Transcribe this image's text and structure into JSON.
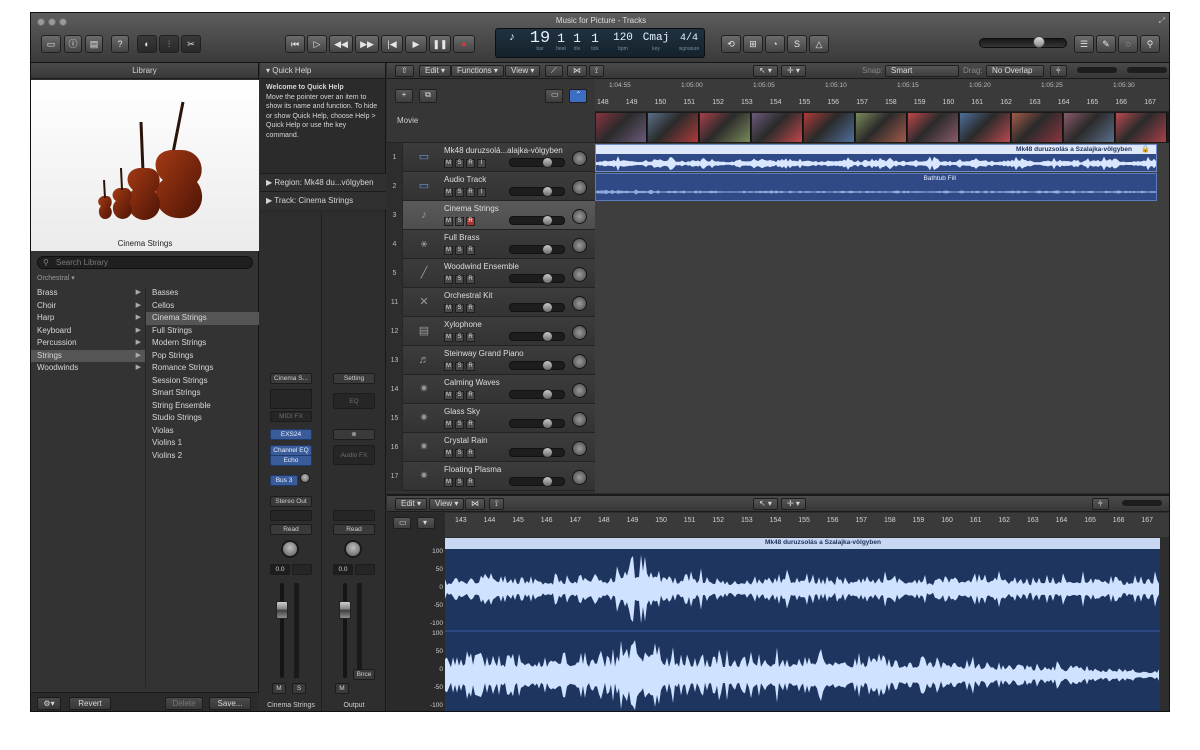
{
  "window": {
    "title": "Music for Picture - Tracks"
  },
  "lcd": {
    "bar": "19",
    "beat": "1",
    "div": "1",
    "tick": "1",
    "tempo": "120",
    "key": "Cmaj",
    "signature": "4/4",
    "labels": {
      "bar": "bar",
      "beat": "beat",
      "div": "div",
      "tick": "tick",
      "bpm": "bpm",
      "key": "key",
      "signature": "signature"
    }
  },
  "library": {
    "header": "Library",
    "selected_instrument": "Cinema Strings",
    "search_placeholder": "Search Library",
    "path": "Orchestral",
    "categories": [
      {
        "label": "Brass",
        "selected": false
      },
      {
        "label": "Choir",
        "selected": false
      },
      {
        "label": "Harp",
        "selected": false
      },
      {
        "label": "Keyboard",
        "selected": false
      },
      {
        "label": "Percussion",
        "selected": false
      },
      {
        "label": "Strings",
        "selected": true
      },
      {
        "label": "Woodwinds",
        "selected": false
      }
    ],
    "patches": [
      {
        "label": "Basses",
        "selected": false
      },
      {
        "label": "Cellos",
        "selected": false
      },
      {
        "label": "Cinema Strings",
        "selected": true
      },
      {
        "label": "Full Strings",
        "selected": false
      },
      {
        "label": "Modern Strings",
        "selected": false
      },
      {
        "label": "Pop Strings",
        "selected": false
      },
      {
        "label": "Romance Strings",
        "selected": false
      },
      {
        "label": "Session Strings",
        "selected": false
      },
      {
        "label": "Smart Strings",
        "selected": false
      },
      {
        "label": "String Ensemble",
        "selected": false
      },
      {
        "label": "Studio Strings",
        "selected": false
      },
      {
        "label": "Violas",
        "selected": false
      },
      {
        "label": "Violins 1",
        "selected": false
      },
      {
        "label": "Violins 2",
        "selected": false
      }
    ],
    "buttons": {
      "revert": "Revert",
      "delete": "Delete",
      "save": "Save..."
    }
  },
  "quick_help": {
    "header": "Quick Help",
    "title": "Welcome to Quick Help",
    "body": "Move the pointer over an item to show its name and function. To hide or show Quick Help, choose Help > Quick Help or use the key command.",
    "region_label": "Region: Mk48 du...völgyben",
    "track_label": "Track:  Cinema Strings"
  },
  "channel_strips": {
    "left": {
      "setting": "Cinema S...",
      "midi_fx": "MIDI FX",
      "instrument": "EXS24",
      "effects": [
        "Channel EQ",
        "Echo"
      ],
      "send": "Bus 3",
      "output": "Stereo Out",
      "automation": "Read",
      "pan_value": "0.0",
      "mute": "M",
      "solo": "S",
      "name": "Cinema Strings"
    },
    "right": {
      "setting": "Setting",
      "eq": "EQ",
      "link": "⊗",
      "audio_fx": "Audio FX",
      "automation": "Read",
      "pan_value": "0.0",
      "bounce": "Bnce",
      "mute": "M",
      "name": "Output"
    }
  },
  "tracks_toolbar": {
    "edit": "Edit",
    "functions": "Functions",
    "view": "View",
    "snap_label": "Snap:",
    "snap_value": "Smart",
    "drag_label": "Drag:",
    "drag_value": "No Overlap"
  },
  "ruler": {
    "bars": [
      "148",
      "149",
      "150",
      "151",
      "152",
      "153",
      "154",
      "155",
      "156",
      "157",
      "158",
      "159",
      "160",
      "161",
      "162",
      "163",
      "164",
      "165",
      "166",
      "167"
    ],
    "times": [
      "1:04:55",
      "1:05:00",
      "1:05:05",
      "1:05:10",
      "1:05:15",
      "1:05:20",
      "1:05:25",
      "1:05:30"
    ]
  },
  "movie_track": {
    "label": "Movie"
  },
  "track_list": [
    {
      "num": "1",
      "name": "Mk48 duruzsolá...alajka-völgyben",
      "buttons": [
        "M",
        "S",
        "R",
        "I"
      ],
      "icon": "audio-waveform-icon",
      "selected": false
    },
    {
      "num": "2",
      "name": "Audio Track",
      "buttons": [
        "M",
        "S",
        "R",
        "I"
      ],
      "icon": "audio-waveform-icon",
      "selected": false
    },
    {
      "num": "3",
      "name": "Cinema Strings",
      "buttons": [
        "M",
        "S",
        "R"
      ],
      "icon": "violin-icon",
      "selected": true
    },
    {
      "num": "4",
      "name": "Full Brass",
      "buttons": [
        "M",
        "S",
        "R"
      ],
      "icon": "trumpet-icon",
      "selected": false
    },
    {
      "num": "5",
      "name": "Woodwind Ensemble",
      "buttons": [
        "M",
        "S",
        "R"
      ],
      "icon": "flute-icon",
      "selected": false
    },
    {
      "num": "11",
      "name": "Orchestral Kit",
      "buttons": [
        "M",
        "S",
        "R"
      ],
      "icon": "drumsticks-icon",
      "selected": false
    },
    {
      "num": "12",
      "name": "Xylophone",
      "buttons": [
        "M",
        "S",
        "R"
      ],
      "icon": "xylophone-icon",
      "selected": false
    },
    {
      "num": "13",
      "name": "Steinway Grand Piano",
      "buttons": [
        "M",
        "S",
        "R"
      ],
      "icon": "piano-icon",
      "selected": false
    },
    {
      "num": "14",
      "name": "Calming Waves",
      "buttons": [
        "M",
        "S",
        "R"
      ],
      "icon": "synth-icon",
      "selected": false
    },
    {
      "num": "15",
      "name": "Glass Sky",
      "buttons": [
        "M",
        "S",
        "R"
      ],
      "icon": "synth-icon",
      "selected": false
    },
    {
      "num": "16",
      "name": "Crystal Rain",
      "buttons": [
        "M",
        "S",
        "R"
      ],
      "icon": "synth-icon",
      "selected": false
    },
    {
      "num": "17",
      "name": "Floating Plasma",
      "buttons": [
        "M",
        "S",
        "R"
      ],
      "icon": "synth-icon",
      "selected": false
    }
  ],
  "regions": [
    {
      "name": "Mk48 duruzsolás a Szalajka-völgyben"
    },
    {
      "name": "Bathtub Fill"
    }
  ],
  "editor": {
    "edit": "Edit",
    "view": "View",
    "bars": [
      "143",
      "144",
      "145",
      "146",
      "147",
      "148",
      "149",
      "150",
      "151",
      "152",
      "153",
      "154",
      "155",
      "156",
      "157",
      "158",
      "159",
      "160",
      "161",
      "162",
      "163",
      "164",
      "165",
      "166",
      "167"
    ],
    "region_name": "Mk48 duruzsolás a Szalajka-völgyben",
    "y_labels_top": [
      "100",
      "50",
      "0",
      "-50",
      "-100"
    ],
    "y_labels_bottom": [
      "100",
      "50",
      "0",
      "-50",
      "-100"
    ]
  },
  "colors": {
    "region_blue": "#2f4a86",
    "wave": "#cfe2ff",
    "editor_bg": "#1e3560",
    "record_red": "#d63a3a"
  }
}
